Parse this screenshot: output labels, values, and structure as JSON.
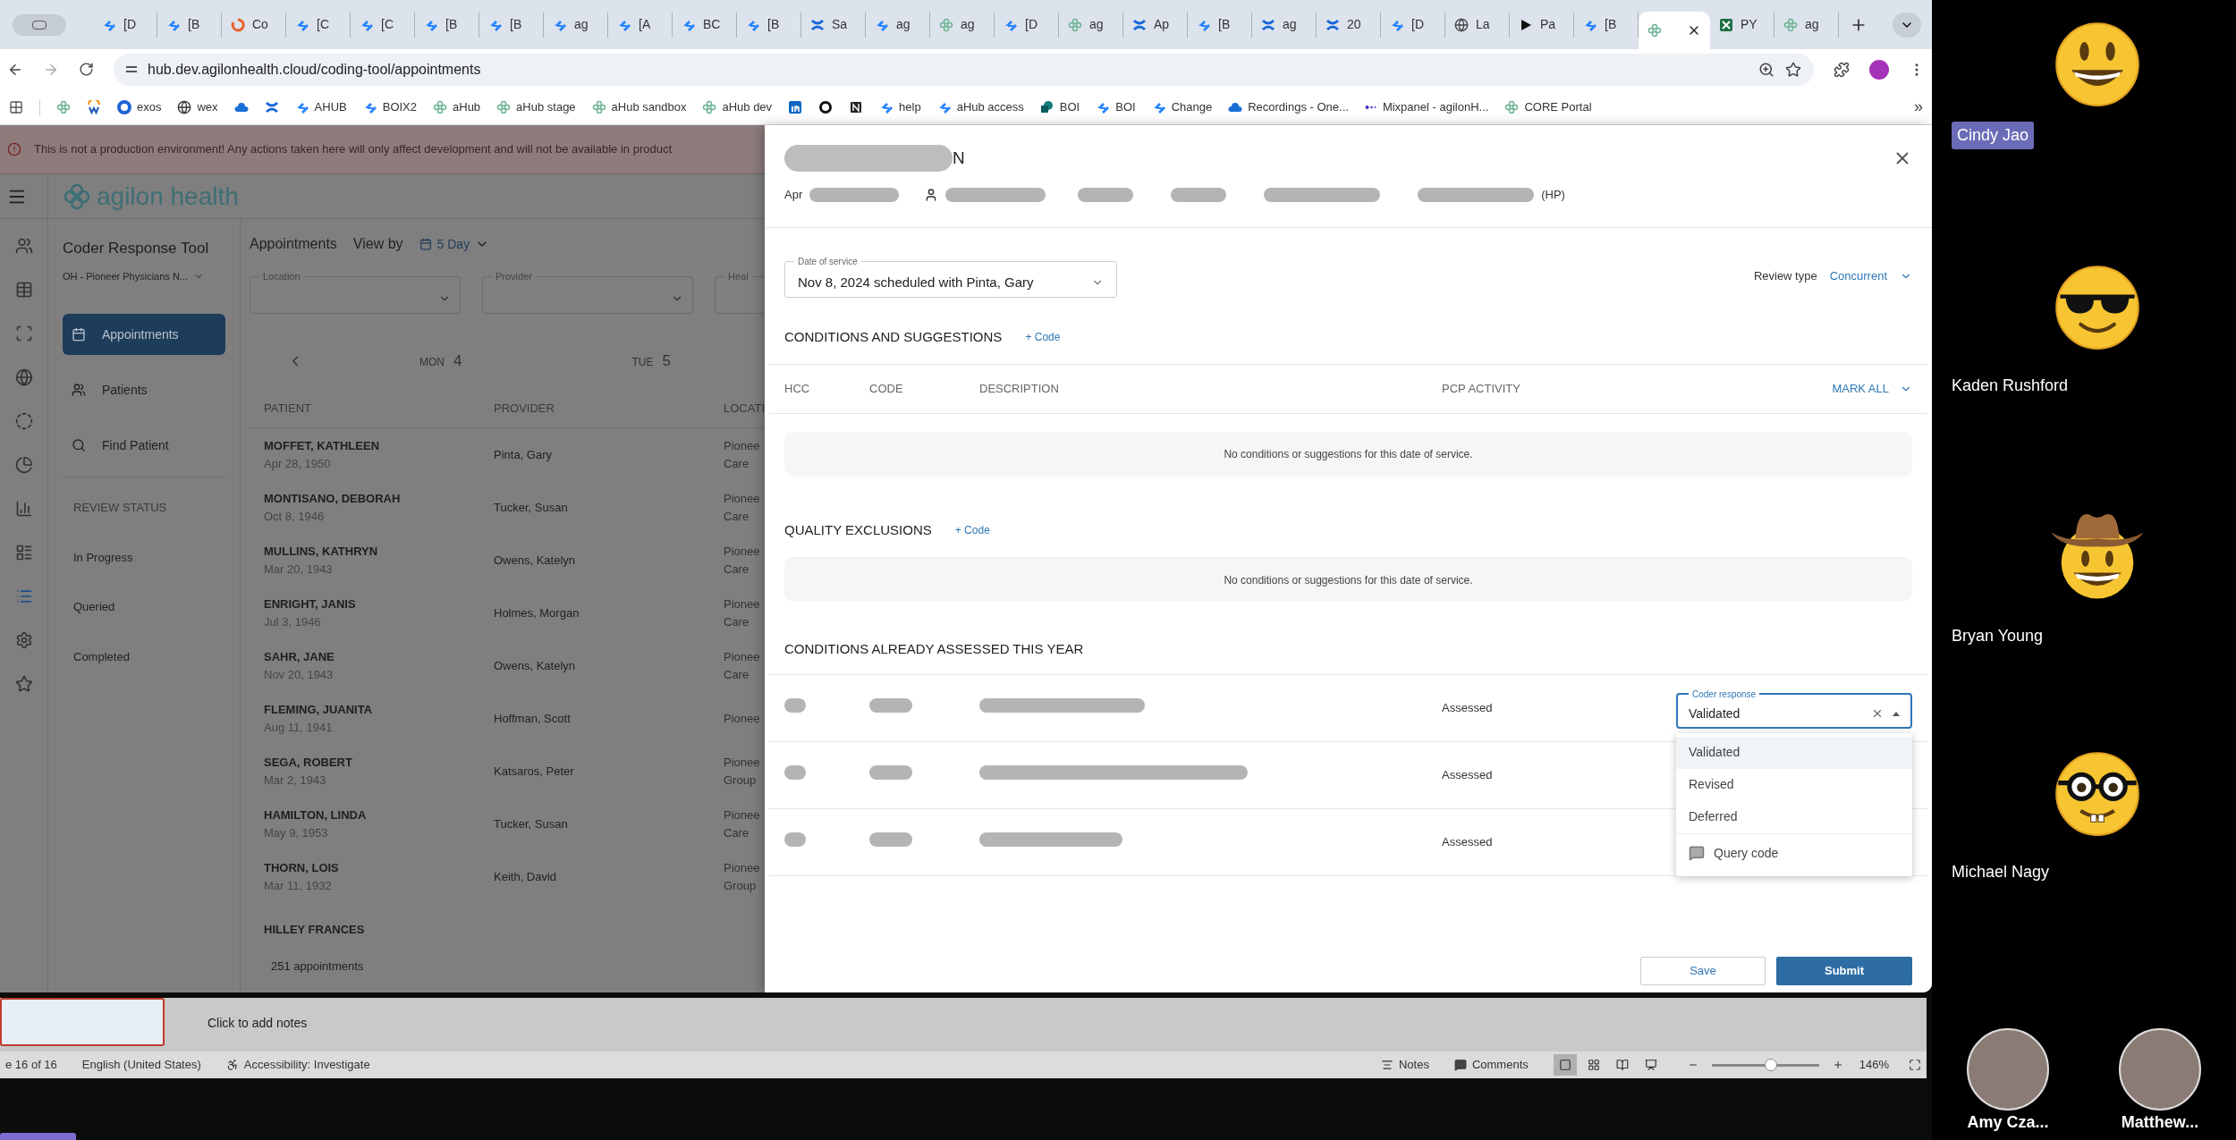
{
  "browser": {
    "tabs": [
      {
        "kind": "jira",
        "label": "[D",
        "selected": false
      },
      {
        "kind": "jira",
        "label": "[B",
        "selected": false
      },
      {
        "kind": "loop",
        "label": "Co",
        "selected": false
      },
      {
        "kind": "jira",
        "label": "[C",
        "selected": false
      },
      {
        "kind": "jira",
        "label": "[C",
        "selected": false
      },
      {
        "kind": "jira",
        "label": "[B",
        "selected": false
      },
      {
        "kind": "jira",
        "label": "[B",
        "selected": false
      },
      {
        "kind": "jira",
        "label": "ag",
        "selected": false
      },
      {
        "kind": "jira",
        "label": "[A",
        "selected": false
      },
      {
        "kind": "jira",
        "label": "BC",
        "selected": false
      },
      {
        "kind": "jira",
        "label": "[B",
        "selected": false
      },
      {
        "kind": "confluence",
        "label": "Sa",
        "selected": false
      },
      {
        "kind": "jira",
        "label": "ag",
        "selected": false
      },
      {
        "kind": "agilon",
        "label": "ag",
        "selected": false
      },
      {
        "kind": "jira",
        "label": "[D",
        "selected": false
      },
      {
        "kind": "agilon",
        "label": "ag",
        "selected": false
      },
      {
        "kind": "confluence",
        "label": "Ap",
        "selected": false
      },
      {
        "kind": "jira",
        "label": "[B",
        "selected": false
      },
      {
        "kind": "confluence",
        "label": "ag",
        "selected": false
      },
      {
        "kind": "confluence",
        "label": "20",
        "selected": false
      },
      {
        "kind": "jira",
        "label": "[D",
        "selected": false
      },
      {
        "kind": "globe",
        "label": "La",
        "selected": false
      },
      {
        "kind": "play",
        "label": "Pa",
        "selected": false
      },
      {
        "kind": "jira",
        "label": "[B",
        "selected": false
      },
      {
        "kind": "agilon",
        "selected": true
      },
      {
        "kind": "excel",
        "label": "PY",
        "selected": false
      },
      {
        "kind": "agilon",
        "label": "ag",
        "selected": false
      }
    ],
    "address": "hub.dev.agilonhealth.cloud/coding-tool/appointments",
    "bookmarks": [
      {
        "kind": "agilon"
      },
      {
        "kind": "webex"
      },
      {
        "kind": "exos",
        "label": "exos"
      },
      {
        "kind": "wex",
        "label": "wex"
      },
      {
        "kind": "cloud"
      },
      {
        "kind": "confluence"
      },
      {
        "kind": "jira",
        "label": "AHUB"
      },
      {
        "kind": "jira",
        "label": "BOIX2"
      },
      {
        "kind": "agilon",
        "label": "aHub"
      },
      {
        "kind": "agilon",
        "label": "aHub stage"
      },
      {
        "kind": "agilon",
        "label": "aHub sandbox"
      },
      {
        "kind": "agilon",
        "label": "aHub dev"
      },
      {
        "kind": "linkedin"
      },
      {
        "kind": "ring"
      },
      {
        "kind": "notion"
      },
      {
        "kind": "jira",
        "label": "help"
      },
      {
        "kind": "jira",
        "label": "aHub access"
      },
      {
        "kind": "sharepoint",
        "label": "BOI"
      },
      {
        "kind": "jira",
        "label": "BOI"
      },
      {
        "kind": "jira",
        "label": "Change"
      },
      {
        "kind": "cloud",
        "label": "Recordings - One..."
      },
      {
        "kind": "mixpanel",
        "label": "Mixpanel - agilonH..."
      },
      {
        "kind": "agilon",
        "label": "CORE Portal"
      }
    ],
    "more_bookmarks": "»"
  },
  "banner": "This is not a production environment! Any actions taken here will only affect development and will not be available in product",
  "app": {
    "logo": "agilon health",
    "title": "Coder Response Tool",
    "organization": "OH - Pioneer Physicians N...",
    "rail": [
      {
        "selected": false
      },
      {
        "selected": false
      },
      {
        "selected": false
      },
      {
        "selected": false
      },
      {
        "selected": false
      },
      {
        "selected": false
      },
      {
        "selected": false
      },
      {
        "selected": false
      },
      {
        "selected": true
      },
      {
        "selected": false
      },
      {
        "selected": false
      }
    ],
    "nav": [
      {
        "label": "Appointments",
        "selected": true
      },
      {
        "label": "Patients",
        "selected": false
      },
      {
        "label": "Find Patient",
        "selected": false
      }
    ],
    "review_status": {
      "heading": "REVIEW STATUS",
      "items": [
        "In Progress",
        "Queried",
        "Completed"
      ]
    },
    "heading": "Appointments",
    "view_by": "View by",
    "view": "5 Day",
    "filters": [
      "Location",
      "Provider",
      "Heal"
    ],
    "days": [
      {
        "weekday": "MON",
        "day": "4"
      },
      {
        "weekday": "TUE",
        "day": "5"
      }
    ],
    "columns": [
      "PATIENT",
      "PROVIDER",
      "LOCATI"
    ],
    "rows": [
      {
        "name": "MOFFET, KATHLEEN",
        "dob": "Apr 28, 1950",
        "provider": "Pinta, Gary",
        "location": [
          "Pionee",
          "Care"
        ]
      },
      {
        "name": "MONTISANO, DEBORAH",
        "dob": "Oct 8, 1946",
        "provider": "Tucker, Susan",
        "location": [
          "Pionee",
          "Care"
        ]
      },
      {
        "name": "MULLINS, KATHRYN",
        "dob": "Mar 20, 1943",
        "provider": "Owens, Katelyn",
        "location": [
          "Pionee",
          "Care"
        ]
      },
      {
        "name": "ENRIGHT, JANIS",
        "dob": "Jul 3, 1946",
        "provider": "Holmes, Morgan",
        "location": [
          "Pionee",
          "Care"
        ]
      },
      {
        "name": "SAHR, JANE",
        "dob": "Nov 20, 1943",
        "provider": "Owens, Katelyn",
        "location": [
          "Pionee",
          "Care"
        ]
      },
      {
        "name": "FLEMING, JUANITA",
        "dob": "Aug 11, 1941",
        "provider": "Hoffman, Scott",
        "location": [
          "Pionee"
        ]
      },
      {
        "name": "SEGA, ROBERT",
        "dob": "Mar 2, 1943",
        "provider": "Katsaros, Peter",
        "location": [
          "Pionee",
          "Group"
        ]
      },
      {
        "name": "HAMILTON, LINDA",
        "dob": "May 9, 1953",
        "provider": "Tucker, Susan",
        "location": [
          "Pionee",
          "Care"
        ]
      },
      {
        "name": "THORN, LOIS",
        "dob": "Mar 11, 1932",
        "provider": "Keith, David",
        "location": [
          "Pionee",
          "Group"
        ]
      },
      {
        "name": "HILLEY FRANCES"
      }
    ],
    "count": "251 appointments"
  },
  "modal": {
    "title_end": "N",
    "dob_prefix": "Apr",
    "id_suffix": "(HP)",
    "date_of_service": {
      "label": "Date of service",
      "value": "Nov 8, 2024 scheduled with Pinta, Gary"
    },
    "review_type": {
      "label": "Review type",
      "value": "Concurrent"
    },
    "conditions": {
      "heading": "CONDITIONS AND SUGGESTIONS",
      "add": "+ Code",
      "columns": [
        "HCC",
        "CODE",
        "DESCRIPTION",
        "PCP ACTIVITY"
      ],
      "mark_all": "MARK ALL",
      "empty": "No conditions or suggestions for this date of service."
    },
    "quality": {
      "heading": "QUALITY EXCLUSIONS",
      "add": "+ Code",
      "empty": "No conditions or suggestions for this date of service."
    },
    "assessed": {
      "heading": "CONDITIONS ALREADY ASSESSED THIS YEAR",
      "rows": [
        {
          "activity": "Assessed"
        },
        {
          "activity": "Assessed"
        },
        {
          "activity": "Assessed"
        }
      ],
      "coder_response": {
        "label": "Coder response",
        "value": "Validated"
      },
      "menu": [
        {
          "kind": "option",
          "label": "Validated",
          "selected": true
        },
        {
          "kind": "option",
          "label": "Revised",
          "selected": false
        },
        {
          "kind": "option",
          "label": "Deferred",
          "selected": false
        },
        {
          "kind": "action",
          "label": "Query code",
          "selected": false
        }
      ]
    },
    "save": "Save",
    "submit": "Submit"
  },
  "office": {
    "notes_placeholder": "Click to add notes",
    "slide": "e 16 of 16",
    "language": "English (United States)",
    "accessibility": "Accessibility: Investigate",
    "notes": "Notes",
    "comments": "Comments",
    "views": [
      {
        "selected": true
      },
      {
        "selected": false
      },
      {
        "selected": false
      },
      {
        "selected": false
      }
    ],
    "zoom": {
      "level": 0.55,
      "reading": "146%"
    }
  },
  "participants": [
    {
      "name": "Cindy Jao",
      "kind": "grin",
      "highlighted": true
    },
    {
      "name": "Kaden Rushford",
      "kind": "sunglasses",
      "highlighted": false
    },
    {
      "name": "Bryan Young",
      "kind": "cowboy",
      "highlighted": false
    },
    {
      "name": "Michael Nagy",
      "kind": "nerd",
      "highlighted": false
    },
    {
      "name": "Amy Cza...",
      "kind": "photo",
      "highlighted": false
    },
    {
      "name": "Matthew...",
      "kind": "photo",
      "highlighted": false
    }
  ]
}
